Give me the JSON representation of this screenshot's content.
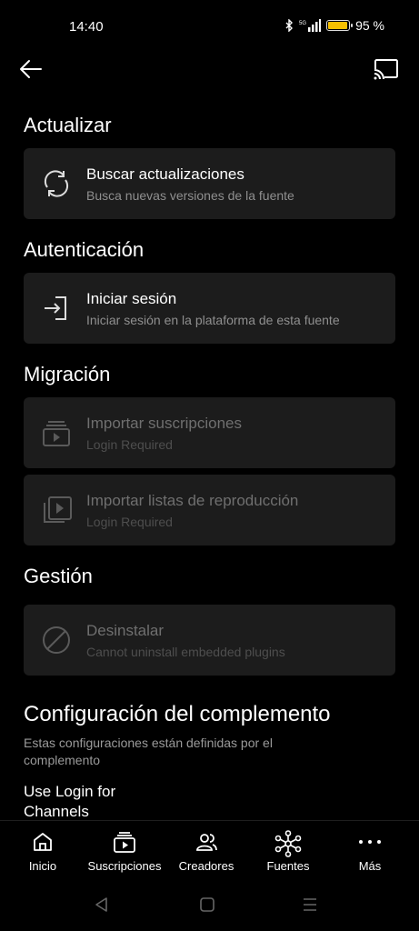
{
  "status": {
    "time": "14:40",
    "battery": "95 %",
    "battery_level": 0.95
  },
  "topbar": {
    "back_icon": "arrow-left-icon",
    "cast_icon": "cast-icon"
  },
  "sections": {
    "update": {
      "title": "Actualizar",
      "check": {
        "title": "Buscar actualizaciones",
        "subtitle": "Busca nuevas versiones de la fuente"
      }
    },
    "auth": {
      "title": "Autenticación",
      "login": {
        "title": "Iniciar sesión",
        "subtitle": "Iniciar sesión en la plataforma de esta fuente"
      }
    },
    "migration": {
      "title": "Migración",
      "subs": {
        "title": "Importar suscripciones",
        "subtitle": "Login Required"
      },
      "playlists": {
        "title": "Importar listas de reproducción",
        "subtitle": "Login Required"
      }
    },
    "manage": {
      "title": "Gestión",
      "uninstall": {
        "title": "Desinstalar",
        "subtitle": "Cannot uninstall embedded plugins"
      }
    }
  },
  "plugin": {
    "title": "Configuración del complemento",
    "description": "Estas configuraciones están definidas por el complemento",
    "setting_label": "Use Login for Channels"
  },
  "nav": [
    {
      "label": "Inicio",
      "icon": "home-icon"
    },
    {
      "label": "Suscripciones",
      "icon": "subscriptions-icon"
    },
    {
      "label": "Creadores",
      "icon": "creators-icon"
    },
    {
      "label": "Fuentes",
      "icon": "sources-icon"
    },
    {
      "label": "Más",
      "icon": "more-icon"
    }
  ],
  "colors": {
    "background": "#000000",
    "card": "#1c1c1c",
    "secondary_text": "#8f8f8f",
    "disabled_text": "#6f6f6f"
  }
}
